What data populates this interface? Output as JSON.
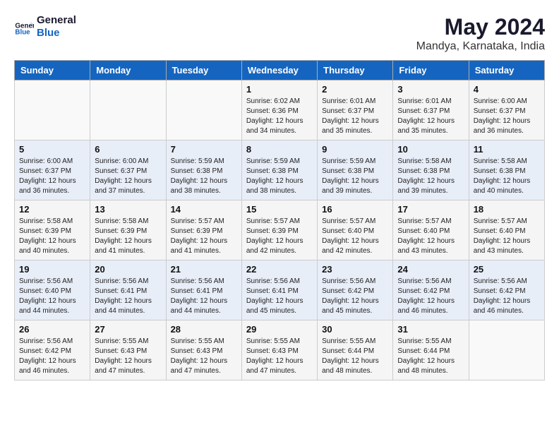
{
  "header": {
    "logo_line1": "General",
    "logo_line2": "Blue",
    "month_year": "May 2024",
    "location": "Mandya, Karnataka, India"
  },
  "weekdays": [
    "Sunday",
    "Monday",
    "Tuesday",
    "Wednesday",
    "Thursday",
    "Friday",
    "Saturday"
  ],
  "weeks": [
    [
      {
        "day": "",
        "info": ""
      },
      {
        "day": "",
        "info": ""
      },
      {
        "day": "",
        "info": ""
      },
      {
        "day": "1",
        "info": "Sunrise: 6:02 AM\nSunset: 6:36 PM\nDaylight: 12 hours\nand 34 minutes."
      },
      {
        "day": "2",
        "info": "Sunrise: 6:01 AM\nSunset: 6:37 PM\nDaylight: 12 hours\nand 35 minutes."
      },
      {
        "day": "3",
        "info": "Sunrise: 6:01 AM\nSunset: 6:37 PM\nDaylight: 12 hours\nand 35 minutes."
      },
      {
        "day": "4",
        "info": "Sunrise: 6:00 AM\nSunset: 6:37 PM\nDaylight: 12 hours\nand 36 minutes."
      }
    ],
    [
      {
        "day": "5",
        "info": "Sunrise: 6:00 AM\nSunset: 6:37 PM\nDaylight: 12 hours\nand 36 minutes."
      },
      {
        "day": "6",
        "info": "Sunrise: 6:00 AM\nSunset: 6:37 PM\nDaylight: 12 hours\nand 37 minutes."
      },
      {
        "day": "7",
        "info": "Sunrise: 5:59 AM\nSunset: 6:38 PM\nDaylight: 12 hours\nand 38 minutes."
      },
      {
        "day": "8",
        "info": "Sunrise: 5:59 AM\nSunset: 6:38 PM\nDaylight: 12 hours\nand 38 minutes."
      },
      {
        "day": "9",
        "info": "Sunrise: 5:59 AM\nSunset: 6:38 PM\nDaylight: 12 hours\nand 39 minutes."
      },
      {
        "day": "10",
        "info": "Sunrise: 5:58 AM\nSunset: 6:38 PM\nDaylight: 12 hours\nand 39 minutes."
      },
      {
        "day": "11",
        "info": "Sunrise: 5:58 AM\nSunset: 6:38 PM\nDaylight: 12 hours\nand 40 minutes."
      }
    ],
    [
      {
        "day": "12",
        "info": "Sunrise: 5:58 AM\nSunset: 6:39 PM\nDaylight: 12 hours\nand 40 minutes."
      },
      {
        "day": "13",
        "info": "Sunrise: 5:58 AM\nSunset: 6:39 PM\nDaylight: 12 hours\nand 41 minutes."
      },
      {
        "day": "14",
        "info": "Sunrise: 5:57 AM\nSunset: 6:39 PM\nDaylight: 12 hours\nand 41 minutes."
      },
      {
        "day": "15",
        "info": "Sunrise: 5:57 AM\nSunset: 6:39 PM\nDaylight: 12 hours\nand 42 minutes."
      },
      {
        "day": "16",
        "info": "Sunrise: 5:57 AM\nSunset: 6:40 PM\nDaylight: 12 hours\nand 42 minutes."
      },
      {
        "day": "17",
        "info": "Sunrise: 5:57 AM\nSunset: 6:40 PM\nDaylight: 12 hours\nand 43 minutes."
      },
      {
        "day": "18",
        "info": "Sunrise: 5:57 AM\nSunset: 6:40 PM\nDaylight: 12 hours\nand 43 minutes."
      }
    ],
    [
      {
        "day": "19",
        "info": "Sunrise: 5:56 AM\nSunset: 6:40 PM\nDaylight: 12 hours\nand 44 minutes."
      },
      {
        "day": "20",
        "info": "Sunrise: 5:56 AM\nSunset: 6:41 PM\nDaylight: 12 hours\nand 44 minutes."
      },
      {
        "day": "21",
        "info": "Sunrise: 5:56 AM\nSunset: 6:41 PM\nDaylight: 12 hours\nand 44 minutes."
      },
      {
        "day": "22",
        "info": "Sunrise: 5:56 AM\nSunset: 6:41 PM\nDaylight: 12 hours\nand 45 minutes."
      },
      {
        "day": "23",
        "info": "Sunrise: 5:56 AM\nSunset: 6:42 PM\nDaylight: 12 hours\nand 45 minutes."
      },
      {
        "day": "24",
        "info": "Sunrise: 5:56 AM\nSunset: 6:42 PM\nDaylight: 12 hours\nand 46 minutes."
      },
      {
        "day": "25",
        "info": "Sunrise: 5:56 AM\nSunset: 6:42 PM\nDaylight: 12 hours\nand 46 minutes."
      }
    ],
    [
      {
        "day": "26",
        "info": "Sunrise: 5:56 AM\nSunset: 6:42 PM\nDaylight: 12 hours\nand 46 minutes."
      },
      {
        "day": "27",
        "info": "Sunrise: 5:55 AM\nSunset: 6:43 PM\nDaylight: 12 hours\nand 47 minutes."
      },
      {
        "day": "28",
        "info": "Sunrise: 5:55 AM\nSunset: 6:43 PM\nDaylight: 12 hours\nand 47 minutes."
      },
      {
        "day": "29",
        "info": "Sunrise: 5:55 AM\nSunset: 6:43 PM\nDaylight: 12 hours\nand 47 minutes."
      },
      {
        "day": "30",
        "info": "Sunrise: 5:55 AM\nSunset: 6:44 PM\nDaylight: 12 hours\nand 48 minutes."
      },
      {
        "day": "31",
        "info": "Sunrise: 5:55 AM\nSunset: 6:44 PM\nDaylight: 12 hours\nand 48 minutes."
      },
      {
        "day": "",
        "info": ""
      }
    ]
  ]
}
